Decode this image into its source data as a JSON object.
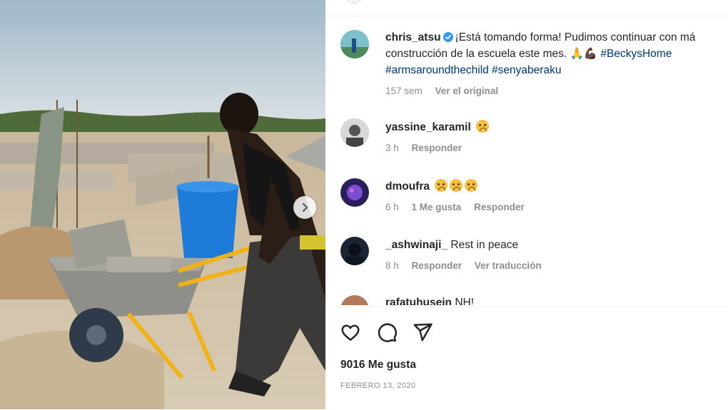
{
  "post": {
    "author": {
      "username": "chris_atsu",
      "verified": true
    },
    "caption": {
      "line1": "¡Está tomando forma! Pudimos continuar con má",
      "line2_text": "construcción de la escuela este mes. ",
      "line2_emojis": "🙏💪🏿",
      "hashtags_line2": "#BeckysHome",
      "hashtags_line3": "#armsaroundthechild #senyaberaku"
    },
    "caption_meta": {
      "age": "157 sem",
      "see_original": "Ver el original"
    }
  },
  "comments": [
    {
      "username": "yassine_karamil",
      "text": "",
      "emoji_count": 1,
      "age": "3 h",
      "likes": "",
      "reply": "Responder",
      "translate": ""
    },
    {
      "username": "dmoufra",
      "text": "",
      "emoji_count": 3,
      "age": "6 h",
      "likes": "1 Me gusta",
      "reply": "Responder",
      "translate": ""
    },
    {
      "username": "_ashwinaji_",
      "text": "Rest in peace",
      "emoji_count": 0,
      "age": "8 h",
      "likes": "",
      "reply": "Responder",
      "translate": "Ver traducción"
    },
    {
      "username": "rafatuhusein",
      "text": "NH!",
      "emoji_count": 0,
      "age": "",
      "likes": "",
      "reply": "",
      "translate": ""
    }
  ],
  "footer": {
    "likes": "9016 Me gusta",
    "date": "FEBRERO 13, 2020"
  },
  "icons": {
    "like": "heart-icon",
    "comment": "comment-icon",
    "share": "share-icon",
    "next": "chevron-right-icon",
    "verified": "verified-badge-icon"
  },
  "colors": {
    "hashtag": "#00376b",
    "verified": "#3897f0",
    "muted": "#8e8e8e"
  }
}
